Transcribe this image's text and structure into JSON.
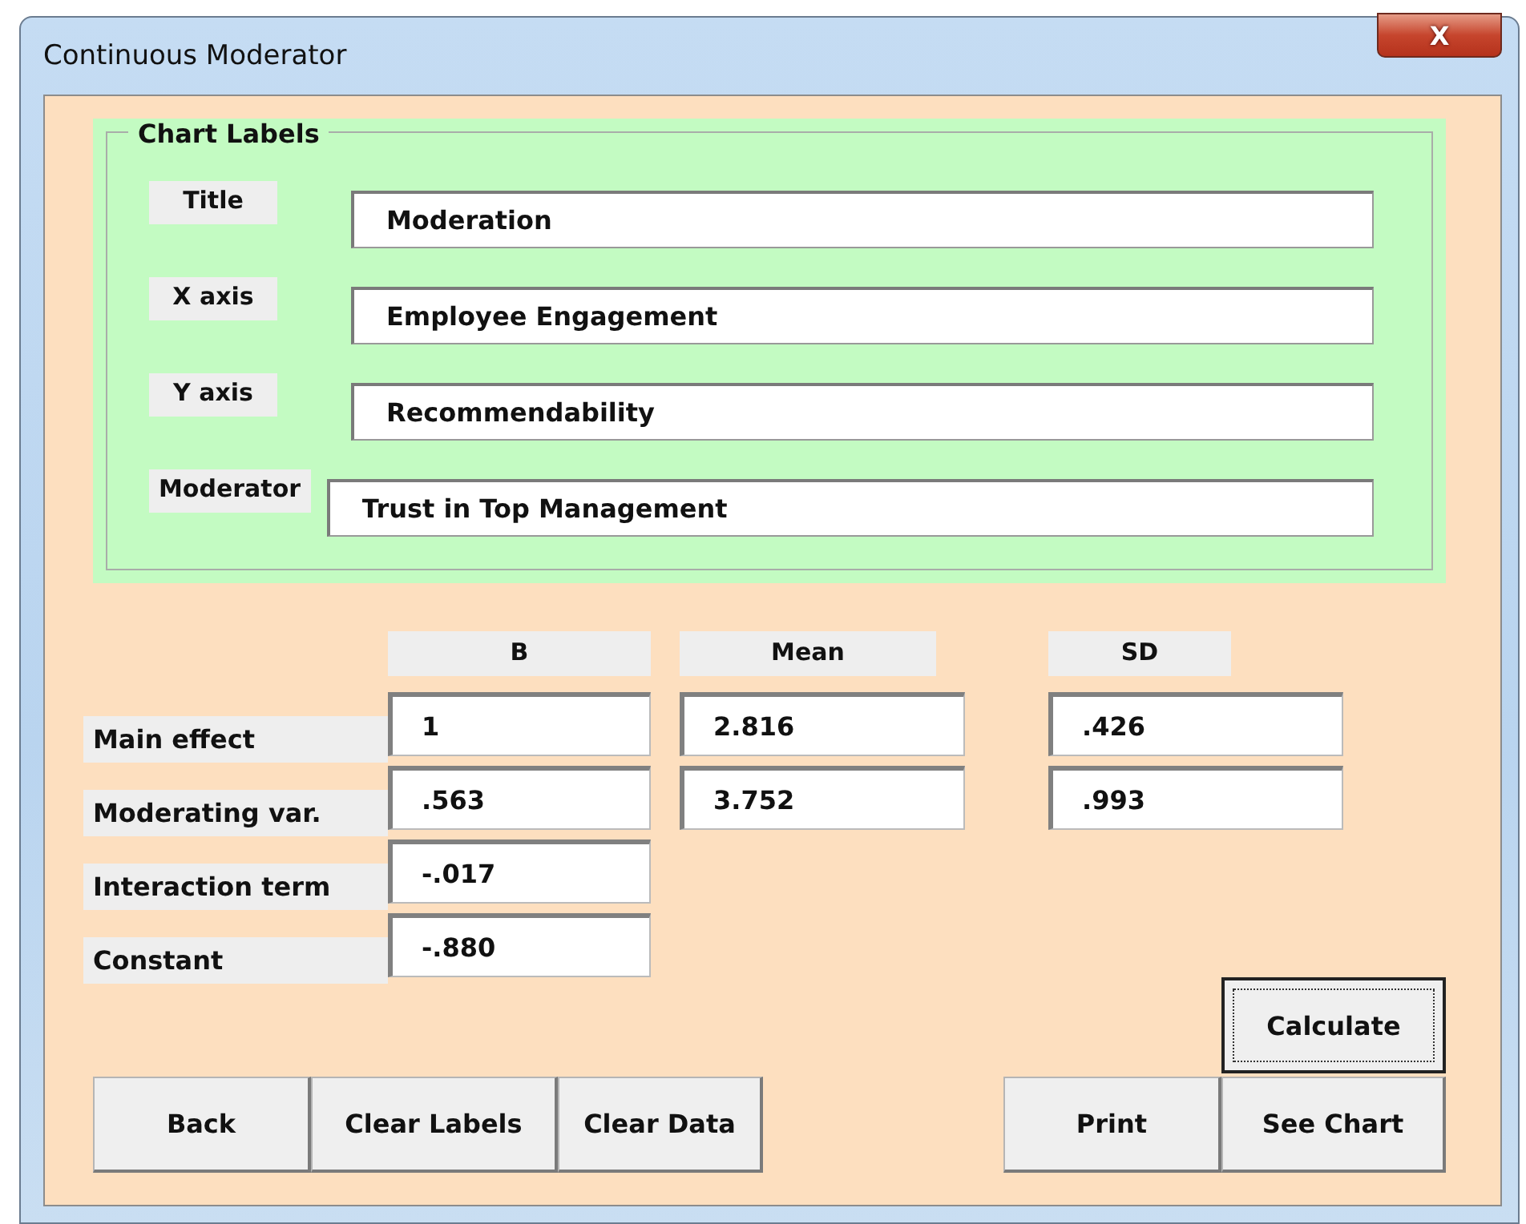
{
  "window": {
    "title": "Continuous Moderator",
    "close_label": "X"
  },
  "chart_labels": {
    "title": "Chart Labels",
    "fields": [
      {
        "label": "Title",
        "value": "Moderation"
      },
      {
        "label": "X axis",
        "value": "Employee Engagement"
      },
      {
        "label": "Y axis",
        "value": "Recommendability"
      },
      {
        "label": "Moderator",
        "value": "Trust in Top Management"
      }
    ]
  },
  "coefficients": {
    "columns": [
      "B",
      "Mean",
      "SD"
    ],
    "rows": [
      {
        "label": "Main effect",
        "b": "1",
        "mean": "2.816",
        "sd": ".426"
      },
      {
        "label": "Moderating var.",
        "b": ".563",
        "mean": "3.752",
        "sd": ".993"
      },
      {
        "label": "Interaction term",
        "b": "-.017"
      },
      {
        "label": "Constant",
        "b": "-.880"
      }
    ]
  },
  "calculate_button": {
    "label": "Calculate",
    "focused": true
  },
  "left_buttons": [
    "Back",
    "Clear Labels",
    "Clear Data"
  ],
  "right_buttons": [
    "Print",
    "See Chart"
  ]
}
